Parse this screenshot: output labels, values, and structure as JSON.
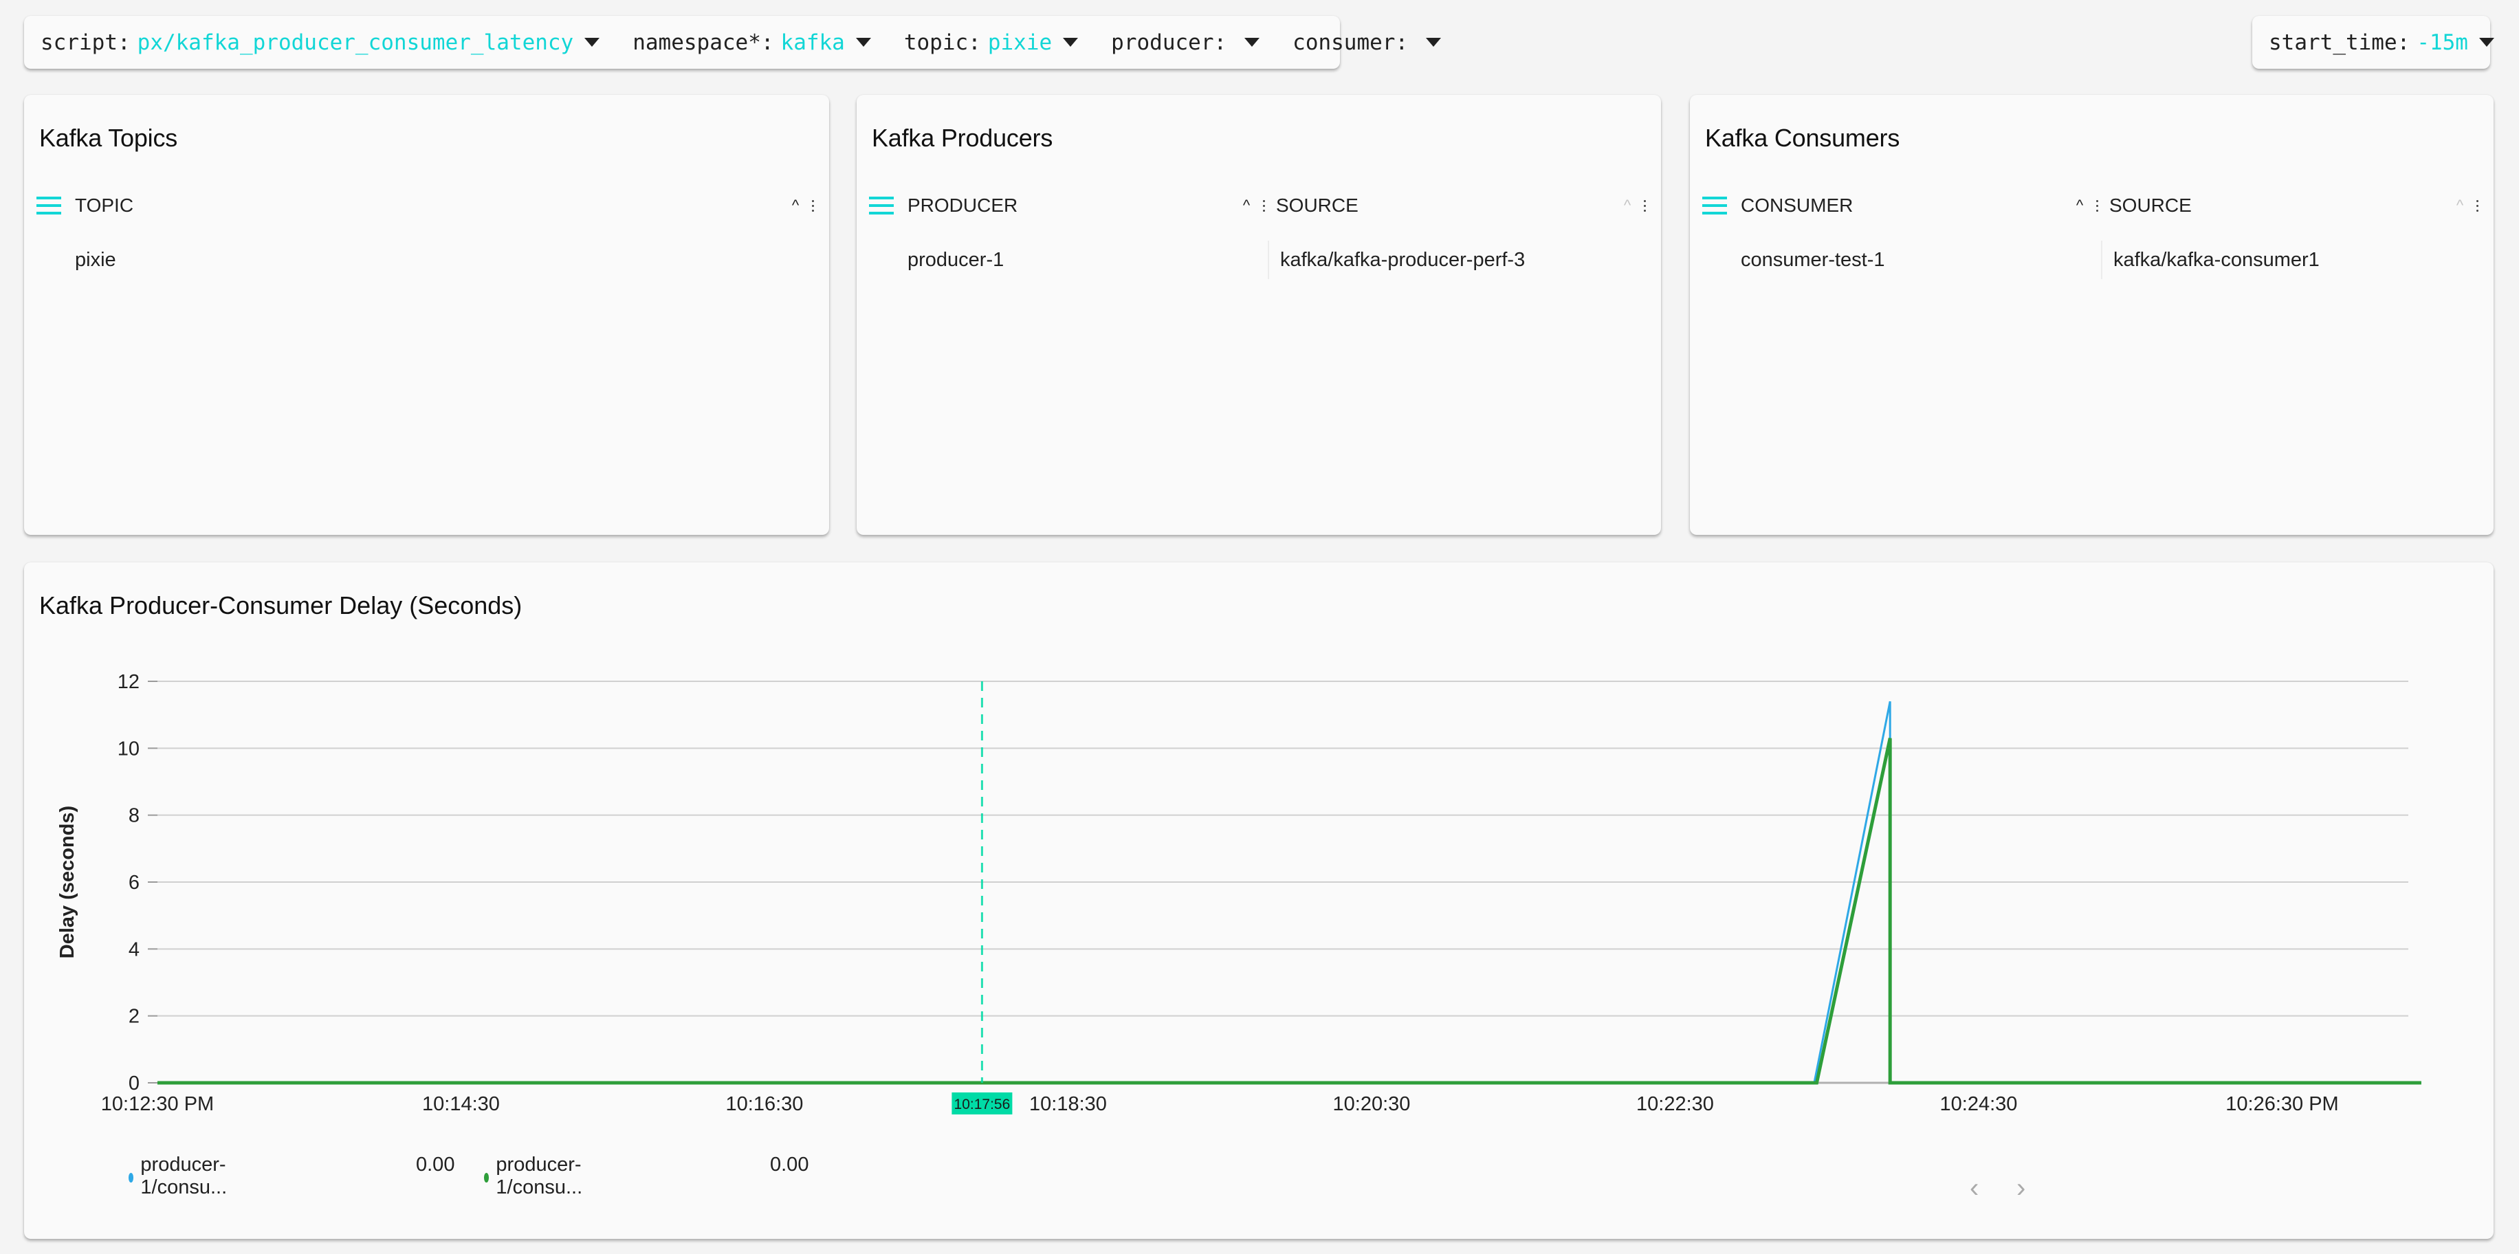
{
  "controls": {
    "script": {
      "label": "script:",
      "value": "px/kafka_producer_consumer_latency"
    },
    "namespace": {
      "label": "namespace*:",
      "value": "kafka"
    },
    "topic": {
      "label": "topic:",
      "value": "pixie"
    },
    "producer": {
      "label": "producer:",
      "value": ""
    },
    "consumer": {
      "label": "consumer:",
      "value": ""
    },
    "start_time": {
      "label": "start_time:",
      "value": "-15m"
    }
  },
  "panels": {
    "topics": {
      "title": "Kafka Topics",
      "columns": [
        "TOPIC"
      ],
      "rows": [
        [
          "pixie"
        ]
      ]
    },
    "producers": {
      "title": "Kafka Producers",
      "columns": [
        "PRODUCER",
        "SOURCE"
      ],
      "rows": [
        [
          "producer-1",
          "kafka/kafka-producer-perf-3"
        ]
      ]
    },
    "consumers": {
      "title": "Kafka Consumers",
      "columns": [
        "CONSUMER",
        "SOURCE"
      ],
      "rows": [
        [
          "consumer-test-1",
          "kafka/kafka-consumer1"
        ]
      ]
    }
  },
  "chart": {
    "hover_time": "10:17:56",
    "legend": [
      {
        "label": "producer-1/consu...",
        "value": "0.00",
        "color": "#2ea8e6"
      },
      {
        "label": "producer-1/consu...",
        "value": "0.00",
        "color": "#2e9e3a"
      }
    ],
    "pager": {
      "prev": "‹",
      "next": "›"
    },
    "crosshair_color": "#00dba6"
  },
  "chart_data": {
    "type": "line",
    "title": "Kafka Producer-Consumer Delay (Seconds)",
    "xlabel": "",
    "ylabel": "Delay (seconds)",
    "xlim_seconds_after_10_12_30": [
      0,
      900
    ],
    "ylim": [
      0,
      12
    ],
    "y_ticks": [
      0,
      2,
      4,
      6,
      8,
      10,
      12
    ],
    "x_ticks": [
      {
        "t": 0,
        "label": "10:12:30 PM"
      },
      {
        "t": 120,
        "label": "10:14:30"
      },
      {
        "t": 240,
        "label": "10:16:30"
      },
      {
        "t": 360,
        "label": "10:18:30"
      },
      {
        "t": 480,
        "label": "10:20:30"
      },
      {
        "t": 600,
        "label": "10:22:30"
      },
      {
        "t": 720,
        "label": "10:24:30"
      },
      {
        "t": 840,
        "label": "10:26:30 PM"
      }
    ],
    "grid": true,
    "legend_placement": "bottom-left",
    "crosshair_t": 326,
    "series": [
      {
        "name": "producer-1/consumer (blue)",
        "color": "#2ea8e6",
        "points": [
          [
            0,
            0
          ],
          [
            655,
            0
          ],
          [
            685,
            11.4
          ],
          [
            685,
            0
          ],
          [
            895,
            0
          ]
        ]
      },
      {
        "name": "producer-1/consumer (green)",
        "color": "#2e9e3a",
        "points": [
          [
            0,
            0
          ],
          [
            656,
            0
          ],
          [
            685,
            10.3
          ],
          [
            685,
            0
          ],
          [
            895,
            0
          ]
        ]
      }
    ]
  }
}
